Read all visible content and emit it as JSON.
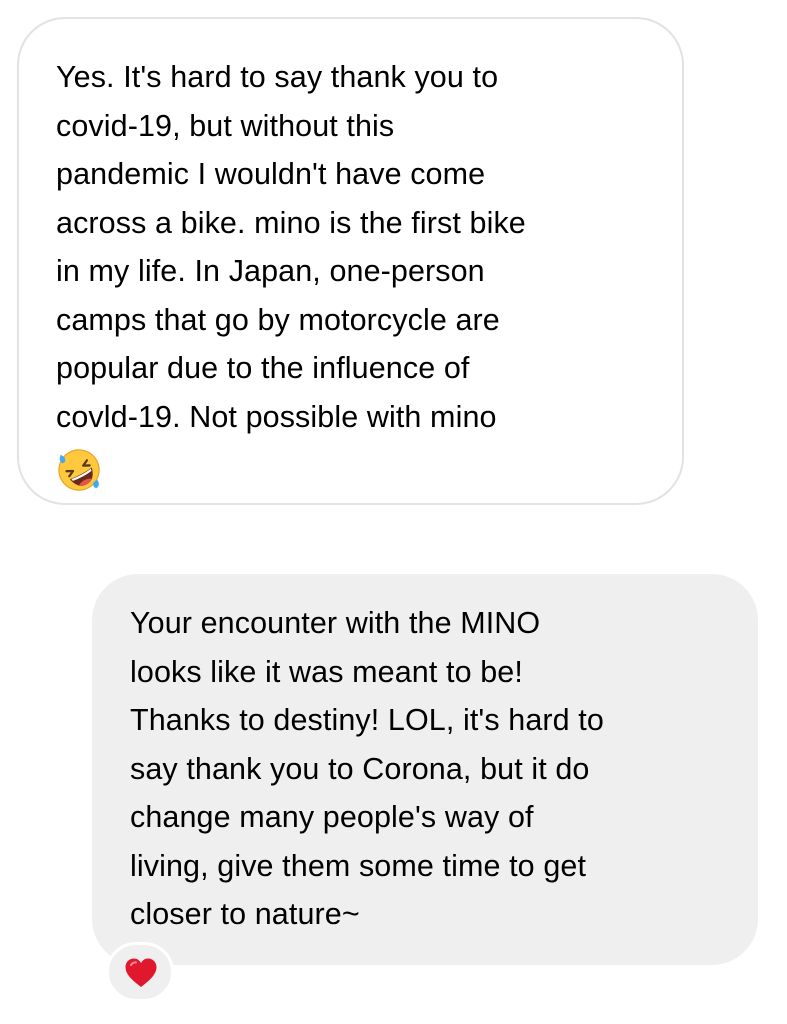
{
  "conversation": {
    "messages": [
      {
        "direction": "incoming",
        "lines": [
          "Yes.  It's hard to say thank you to",
          "covid-19, but without this",
          "pandemic I wouldn't have come",
          "across a bike.  mino is the first bike",
          "in my life.  In Japan, one-person",
          "camps that go by motorcycle are",
          "popular due to the influence of",
          "covld-19.  Not possible with mino"
        ],
        "emoji": "rolling-on-the-floor-laughing-icon"
      },
      {
        "direction": "outgoing",
        "lines": [
          "Your encounter with the MINO",
          "looks like it was meant to be!",
          "Thanks to destiny! LOL, it's hard to",
          "say thank you to Corona, but it do",
          "change many people's way of",
          "living, give them some time to get",
          "closer to nature~"
        ],
        "reaction": "red-heart-icon"
      }
    ]
  },
  "colors": {
    "incoming_bubble_bg": "#ffffff",
    "incoming_bubble_border": "#e2e2e2",
    "outgoing_bubble_bg": "#efefef",
    "text": "#000000",
    "heart": "#e0182d",
    "emoji_face": "#ffc83d"
  }
}
